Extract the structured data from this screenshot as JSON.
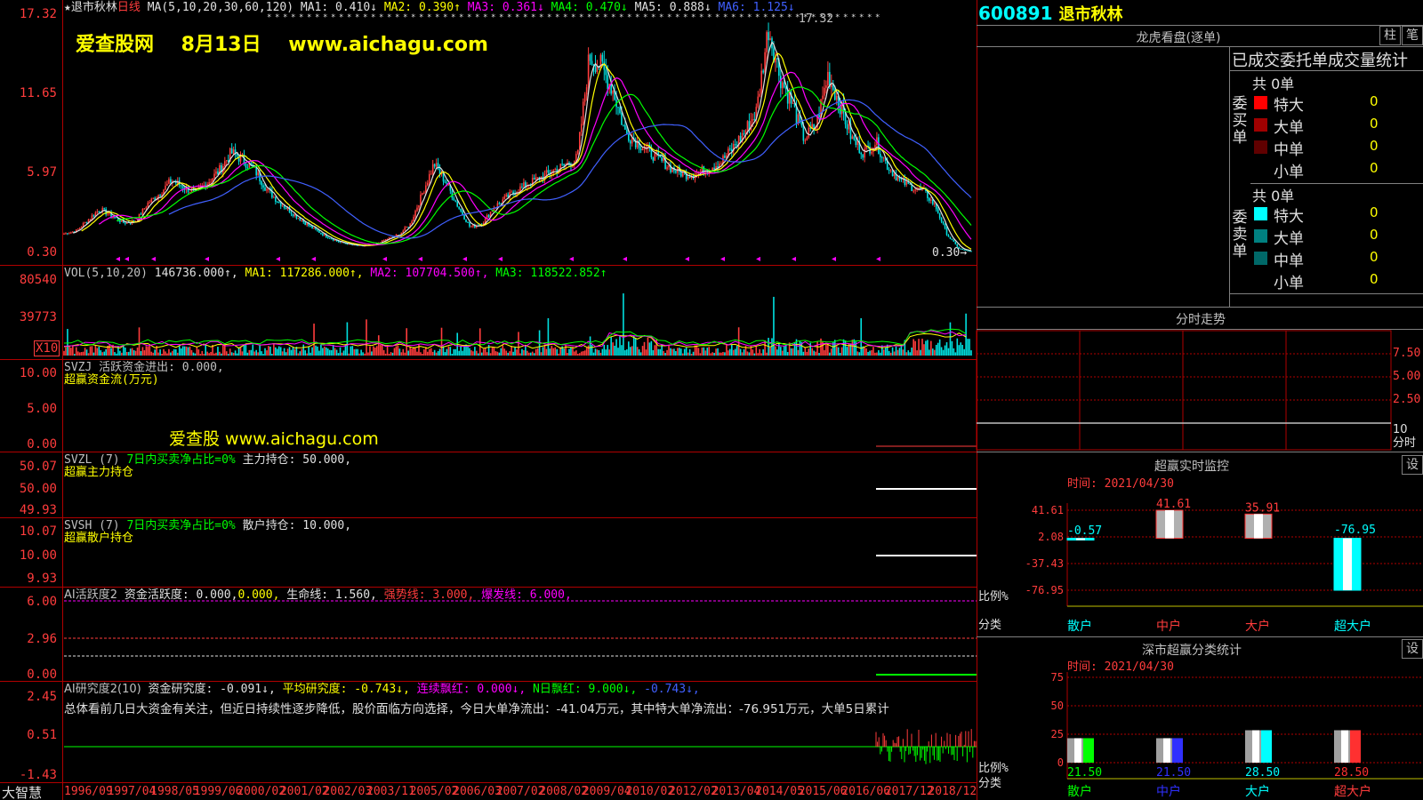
{
  "main_chart": {
    "star": "★",
    "stock_name": "退市秋林",
    "period": "日线",
    "ma_label": "MA(5,10,20,30,60,120)",
    "ma": [
      {
        "label": "MA1: 0.410↓",
        "color": "#e0e0e0"
      },
      {
        "label": "MA2: 0.390↑",
        "color": "#ffff00"
      },
      {
        "label": "MA3: 0.361↓",
        "color": "#ff00ff"
      },
      {
        "label": "MA4: 0.470↓",
        "color": "#00ff00"
      },
      {
        "label": "MA5: 0.888↓",
        "color": "#e0e0e0"
      },
      {
        "label": "MA6: 1.125↓",
        "color": "#4060ff"
      }
    ],
    "watermark": {
      "site": "爱查股网",
      "date": "8月13日",
      "url": "www.aichagu.com"
    },
    "y_ticks": [
      "17.32",
      "11.65",
      "5.97",
      "0.30"
    ],
    "high_label": "17.32",
    "low_label": "0.30",
    "price_series": [
      1.6,
      1.8,
      2.6,
      3.4,
      2.9,
      2.4,
      2.5,
      3.8,
      4.5,
      5.5,
      5.0,
      4.6,
      5.3,
      6.2,
      7.5,
      7.0,
      6.2,
      4.8,
      3.9,
      3.2,
      2.5,
      1.9,
      1.4,
      1.0,
      0.8,
      0.7,
      0.8,
      1.2,
      1.5,
      2.3,
      4.5,
      6.7,
      5.3,
      3.6,
      2.1,
      2.3,
      3.5,
      4.2,
      4.8,
      5.3,
      5.7,
      6.2,
      6.6,
      7.1,
      14.5,
      13.8,
      12.0,
      9.0,
      8.3,
      7.6,
      6.9,
      6.3,
      5.9,
      6.0,
      6.4,
      6.8,
      7.8,
      9.0,
      10.5,
      16.6,
      13.0,
      11.0,
      8.5,
      9.5,
      13.2,
      11.0,
      8.5,
      7.5,
      8.3,
      6.5,
      5.5,
      5.0,
      4.7,
      3.6,
      1.5,
      0.5,
      0.3
    ]
  },
  "volume": {
    "label": "VOL(5,10,20)",
    "value": "146736.000↑,",
    "ma": [
      {
        "label": "MA1: 117286.000↑,",
        "color": "#ffff00"
      },
      {
        "label": "MA2: 107704.500↑,",
        "color": "#ff00ff"
      },
      {
        "label": "MA3: 118522.852↑",
        "color": "#00ff00"
      }
    ],
    "y_ticks": [
      "80540",
      "39773"
    ],
    "multiplier": "X10"
  },
  "svzj": {
    "line1": "SVZJ  活跃资金进出: 0.000,",
    "line2": "超赢资金流(万元)",
    "watermark": "爱查股 www.aichagu.com",
    "y_ticks": [
      "10.00",
      "5.00",
      "0.00"
    ]
  },
  "svzl": {
    "name": "SVZL (7)",
    "desc": "7日内买卖净占比=0%",
    "value": "主力持仓: 50.000,",
    "line2": "超赢主力持仓",
    "y_ticks": [
      "50.07",
      "50.00",
      "49.93"
    ]
  },
  "svsh": {
    "name": "SVSH (7)",
    "desc": "7日内买卖净占比=0%",
    "value": "散户持仓: 10.000,",
    "line2": "超赢散户持仓",
    "y_ticks": [
      "10.07",
      "10.00",
      "9.93"
    ]
  },
  "ai_active": {
    "name": "AI活跃度2",
    "v1": "资金活跃度: 0.000,",
    "v2": "0.000,",
    "v3": "生命线: 1.560,",
    "v4": "强势线: 3.000,",
    "v5": "爆发线: 6.000,",
    "y_ticks": [
      "6.00",
      "2.96",
      "0.00"
    ]
  },
  "ai_research": {
    "name": "AI研究度2(10)",
    "v1": "资金研究度: -0.091↓,",
    "v2": "平均研究度: -0.743↓,",
    "v3": "连续飘红: 0.000↓,",
    "v4": "N日飘红: 9.000↓,",
    "v5": "-0.743↓,",
    "summary": "总体看前几日大资金有关注，但近日持续性逐步降低，股价面临方向选择，今日大单净流出：-41.04万元，其中特大单净流出：-76.951万元，大单5日累计",
    "y_ticks": [
      "2.45",
      "0.51",
      "-1.43"
    ]
  },
  "x_axis": {
    "brand": "大智慧",
    "labels": [
      "1996/09",
      "1997/04",
      "1998/05",
      "1999/06",
      "2000/02",
      "2001/02",
      "2002/03",
      "2003/11",
      "2005/02",
      "2006/03",
      "2007/02",
      "2008/02",
      "2009/04",
      "2010/02",
      "2012/02",
      "2013/04",
      "2014/05",
      "2015/06",
      "2016/06",
      "2017/12",
      "2018/12"
    ]
  },
  "right": {
    "code": "600891",
    "name": "退市秋林",
    "lhb_title": "龙虎看盘(逐单)",
    "btn_zhu": "柱",
    "btn_bi": "笔",
    "stats_title": "已成交委托单成交量统计",
    "buy": {
      "label": "委买单",
      "total": "共 0单",
      "rows": [
        {
          "name": "特大",
          "value": "0",
          "color": "#ff0000"
        },
        {
          "name": "大单",
          "value": "0",
          "color": "#a00000"
        },
        {
          "name": "中单",
          "value": "0",
          "color": "#600000"
        },
        {
          "name": "小单",
          "value": "0",
          "color": "#000000"
        }
      ]
    },
    "sell": {
      "label": "委卖单",
      "total": "共 0单",
      "rows": [
        {
          "name": "特大",
          "value": "0",
          "color": "#00ffff"
        },
        {
          "name": "大单",
          "value": "0",
          "color": "#008080"
        },
        {
          "name": "中单",
          "value": "0",
          "color": "#006868"
        },
        {
          "name": "小单",
          "value": "0",
          "color": "#000000"
        }
      ]
    },
    "fs_title": "分时走势",
    "fs_y": [
      "7.50",
      "5.00",
      "2.50"
    ],
    "fs_unit": "10\n分时",
    "fs_unit_a": "10",
    "fs_unit_b": "分时",
    "monitor_title": "超赢实时监控",
    "settings": "设",
    "monitor_date": "时间: 2021/04/30",
    "monitor_y": [
      "41.61",
      "2.08",
      "-37.43",
      "-76.95"
    ],
    "monitor_values": [
      {
        "cat": "散户",
        "value": -0.57,
        "label": "-0.57",
        "cat_color": "#00ffff",
        "label_color": "#00ffff"
      },
      {
        "cat": "中户",
        "value": 41.61,
        "label": "41.61",
        "cat_color": "#ff3c3c",
        "label_color": "#ff3c3c"
      },
      {
        "cat": "大户",
        "value": 35.91,
        "label": "35.91",
        "cat_color": "#ff3c3c",
        "label_color": "#ff3c3c"
      },
      {
        "cat": "超大户",
        "value": -76.95,
        "label": "-76.95",
        "cat_color": "#00ffff",
        "label_color": "#00ffff"
      }
    ],
    "ratio_label": "比例%",
    "class_label": "分类",
    "stat_title": "深市超赢分类统计",
    "stat_date": "时间: 2021/04/30",
    "stat_y": [
      "75",
      "50",
      "25",
      "0"
    ],
    "stat_values": [
      {
        "cat": "散户",
        "value": 21.5,
        "label": "21.50",
        "color": "#00ff00",
        "cat_color": "#00ff00"
      },
      {
        "cat": "中户",
        "value": 21.5,
        "label": "21.50",
        "color": "#3030ff",
        "cat_color": "#3030ff"
      },
      {
        "cat": "大户",
        "value": 28.5,
        "label": "28.50",
        "color": "#00ffff",
        "cat_color": "#00ffff"
      },
      {
        "cat": "超大户",
        "value": 28.5,
        "label": "28.50",
        "color": "#ff3030",
        "cat_color": "#ff3c3c"
      }
    ]
  }
}
